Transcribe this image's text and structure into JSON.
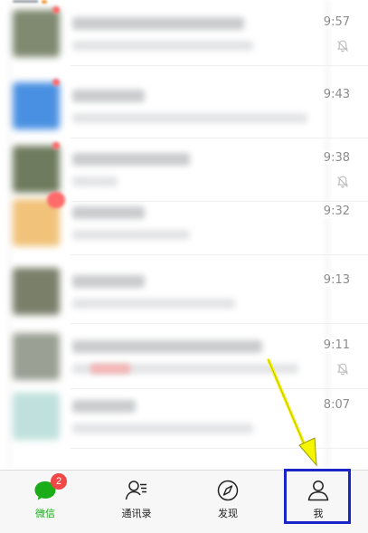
{
  "chats": [
    {
      "time": "9:57",
      "muted": true,
      "avatar_color": "#7f8a70",
      "mark": "dot",
      "title_w": 190,
      "sub_w": 200
    },
    {
      "time": "9:43",
      "muted": false,
      "avatar_color": "#4a90e2",
      "mark": "dot",
      "title_w": 80,
      "sub_w": 260
    },
    {
      "time": "9:38",
      "muted": true,
      "avatar_color": "#6f7b5e",
      "mark": "dot",
      "title_w": 130,
      "sub_w": 50
    },
    {
      "time": "9:32",
      "muted": false,
      "avatar_color": "#f1c27a",
      "mark": "badge",
      "title_w": 80,
      "sub_w": 130
    },
    {
      "time": "9:13",
      "muted": false,
      "avatar_color": "#7a7f6a",
      "mark": "none",
      "title_w": 80,
      "sub_w": 180
    },
    {
      "time": "9:11",
      "muted": true,
      "avatar_color": "#9aa093",
      "mark": "none",
      "title_w": 210,
      "sub_w": 250
    },
    {
      "time": "8:07",
      "muted": false,
      "avatar_color": "#bfe0dc",
      "mark": "none",
      "title_w": 70,
      "sub_w": 200
    }
  ],
  "tabbar": {
    "tabs": [
      {
        "label": "微信",
        "icon": "chat-bubble-icon",
        "active": true,
        "badge": "2"
      },
      {
        "label": "通讯录",
        "icon": "contacts-icon",
        "active": false
      },
      {
        "label": "发现",
        "icon": "compass-icon",
        "active": false
      },
      {
        "label": "我",
        "icon": "person-icon",
        "active": false
      }
    ]
  },
  "colors": {
    "accent_green": "#1aad19",
    "badge_red": "#f04747",
    "highlight_blue": "#1a24c8",
    "arrow_yellow": "#f5f500"
  }
}
